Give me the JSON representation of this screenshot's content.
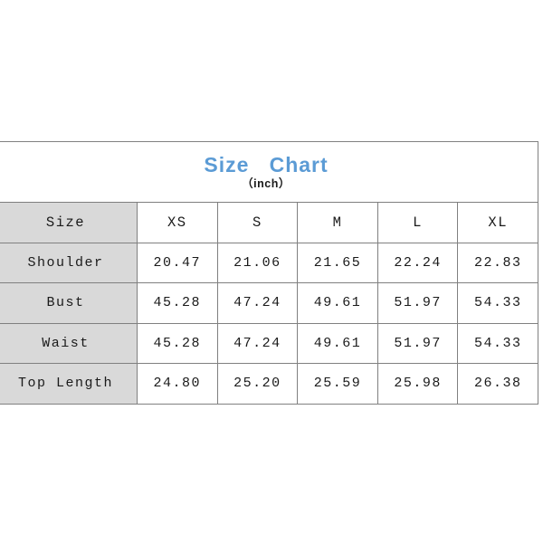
{
  "chart_data": {
    "type": "table",
    "title": "Size   Chart",
    "subtitle": "（inch）",
    "unit": "inch",
    "columns": [
      "Size",
      "XS",
      "S",
      "M",
      "L",
      "XL"
    ],
    "rows": [
      {
        "label": "Shoulder",
        "values": [
          "20.47",
          "21.06",
          "21.65",
          "22.24",
          "22.83"
        ]
      },
      {
        "label": "Bust",
        "values": [
          "45.28",
          "47.24",
          "49.61",
          "51.97",
          "54.33"
        ]
      },
      {
        "label": "Waist",
        "values": [
          "45.28",
          "47.24",
          "49.61",
          "51.97",
          "54.33"
        ]
      },
      {
        "label": "Top Length",
        "values": [
          "24.80",
          "25.20",
          "25.59",
          "25.98",
          "26.38"
        ]
      }
    ],
    "colors": {
      "title": "#5b9bd5",
      "label_cell_background": "#d9d9d9",
      "value_cell_background": "#ffffff",
      "border": "#808080",
      "text": "#1a1a1a",
      "page_background": "#ffffff"
    }
  }
}
